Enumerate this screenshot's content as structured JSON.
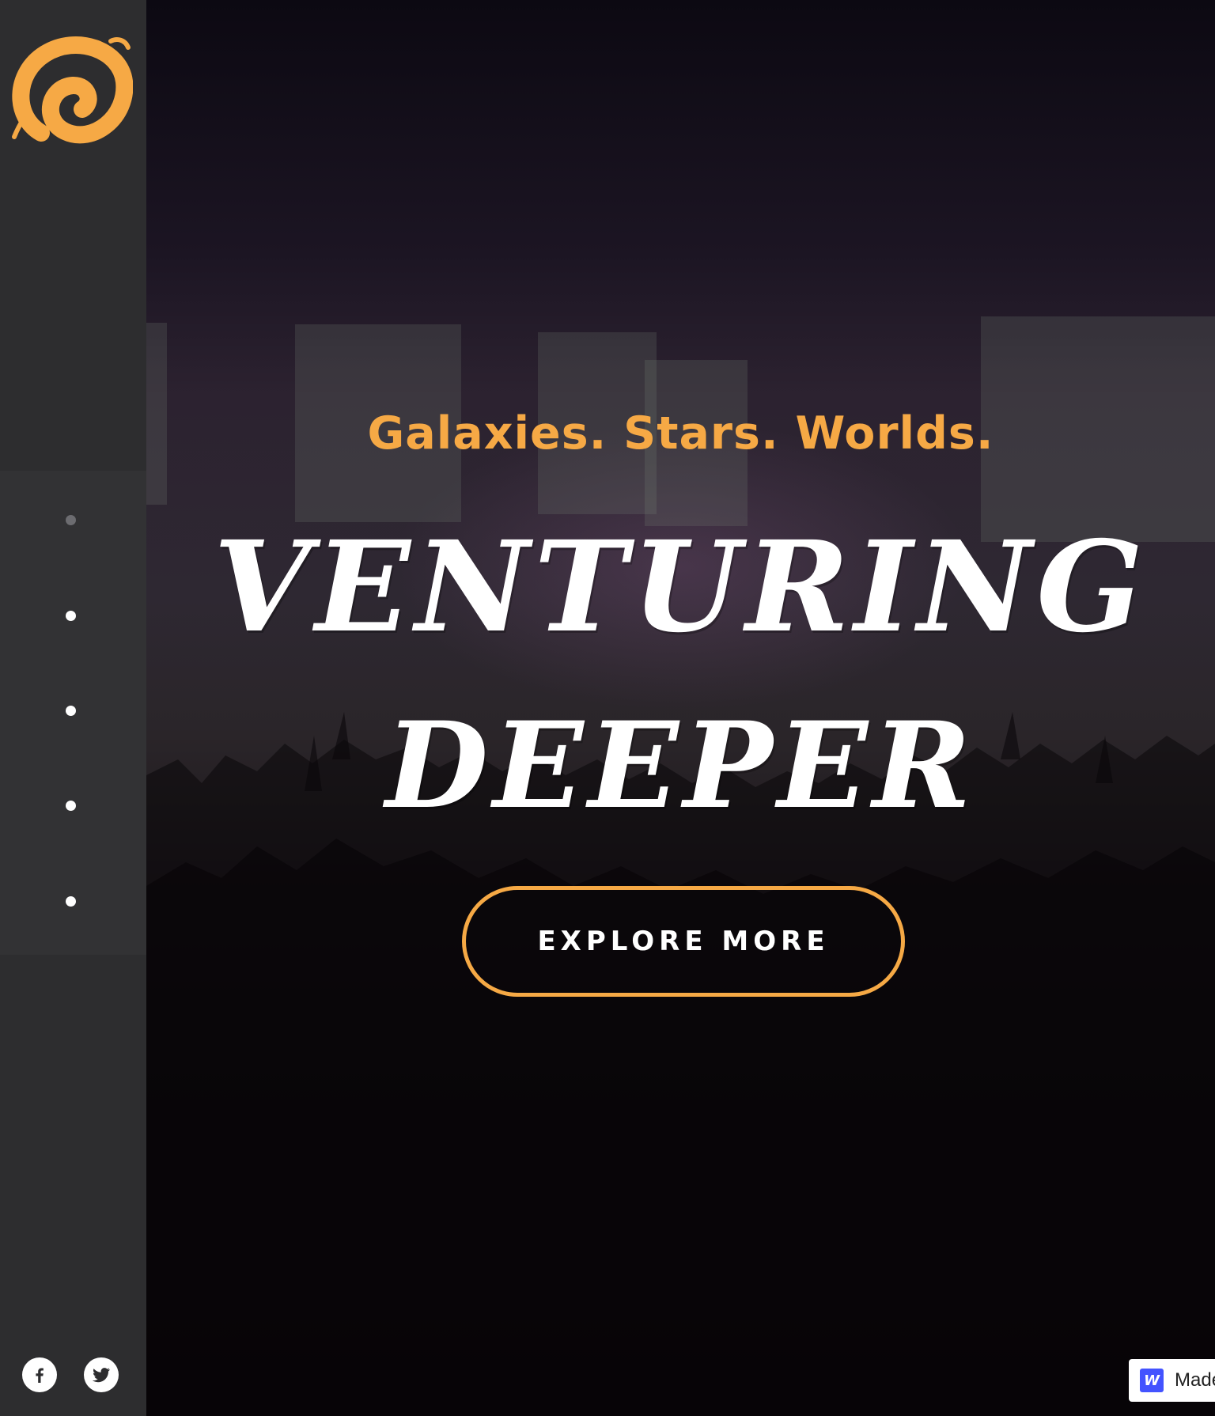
{
  "brand": {
    "logo": "swirl-logo",
    "accent": "#f6a945"
  },
  "sidebar": {
    "background": "#2d2d2f",
    "nav_dots": [
      {
        "index": 1,
        "active": true
      },
      {
        "index": 2,
        "active": false
      },
      {
        "index": 3,
        "active": false
      },
      {
        "index": 4,
        "active": false
      },
      {
        "index": 5,
        "active": false
      }
    ],
    "social": [
      {
        "name": "facebook",
        "icon": "facebook-icon"
      },
      {
        "name": "twitter",
        "icon": "twitter-icon"
      }
    ]
  },
  "hero": {
    "tagline": "Galaxies. Stars. Worlds.",
    "headline_line1": "Venturing",
    "headline_line2": "Deeper",
    "cta_label": "EXPLORE MORE",
    "background_image": "concert-crowd-photo"
  },
  "badge": {
    "label": "Made in Webflow",
    "mark": "W",
    "mark_color": "#4353ff"
  }
}
